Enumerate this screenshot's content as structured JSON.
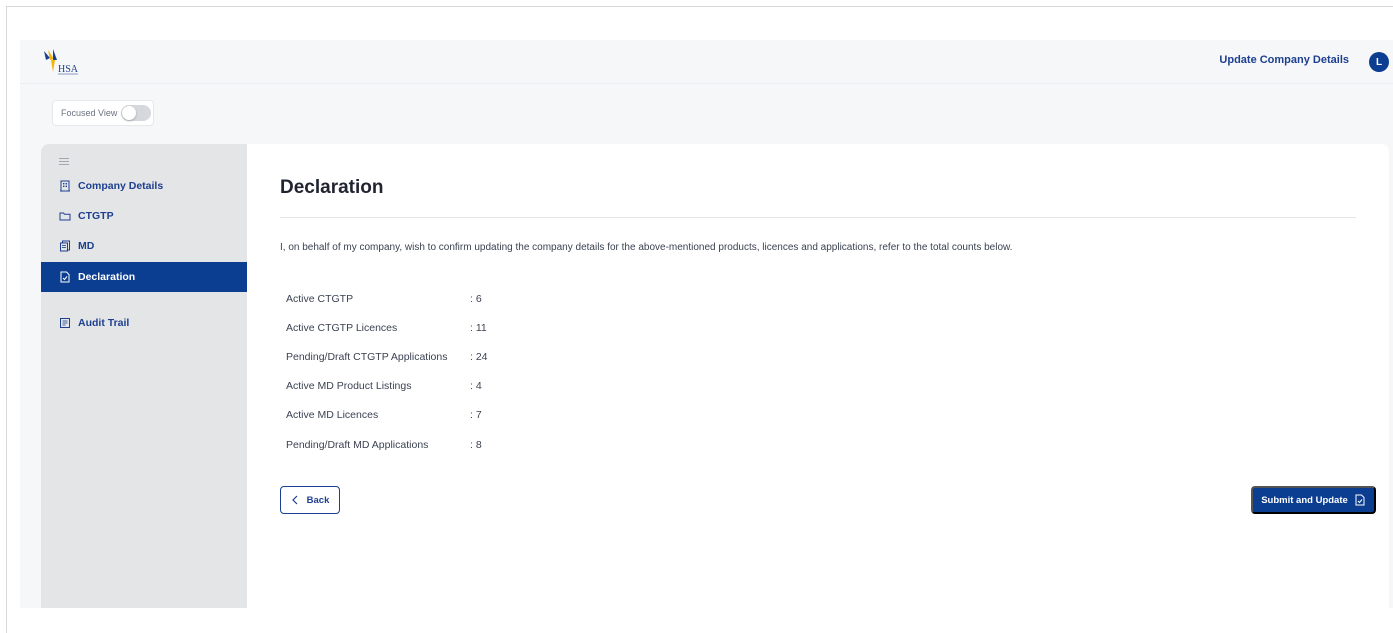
{
  "header": {
    "logo_text": "HSA",
    "update_link": "Update Company Details",
    "avatar_initial": "L"
  },
  "focused_view": {
    "label": "Focused View",
    "enabled": false
  },
  "sidebar": {
    "items": [
      {
        "label": "Company Details",
        "icon": "building-icon",
        "active": false
      },
      {
        "label": "CTGTP",
        "icon": "folder-icon",
        "active": false
      },
      {
        "label": "MD",
        "icon": "documents-icon",
        "active": false
      },
      {
        "label": "Declaration",
        "icon": "document-check-icon",
        "active": true
      },
      {
        "label": "Audit Trail",
        "icon": "audit-icon",
        "active": false
      }
    ]
  },
  "main": {
    "title": "Declaration",
    "statement": "I, on behalf of my company, wish to confirm updating the company details for the above-mentioned products, licences and applications, refer to the total counts below.",
    "counts": [
      {
        "label": "Active CTGTP",
        "value": ": 6"
      },
      {
        "label": "Active CTGTP Licences",
        "value": ": 11"
      },
      {
        "label": "Pending/Draft CTGTP Applications",
        "value": ": 24"
      },
      {
        "label": "Active MD Product Listings",
        "value": ": 4"
      },
      {
        "label": "Active MD Licences",
        "value": ": 7"
      },
      {
        "label": "Pending/Draft MD Applications",
        "value": ": 8"
      }
    ],
    "back_label": "Back",
    "submit_label": "Submit and Update"
  },
  "colors": {
    "primary": "#0b3d91",
    "sidebar_bg": "#e4e5e7",
    "page_bg": "#f6f7f8"
  }
}
